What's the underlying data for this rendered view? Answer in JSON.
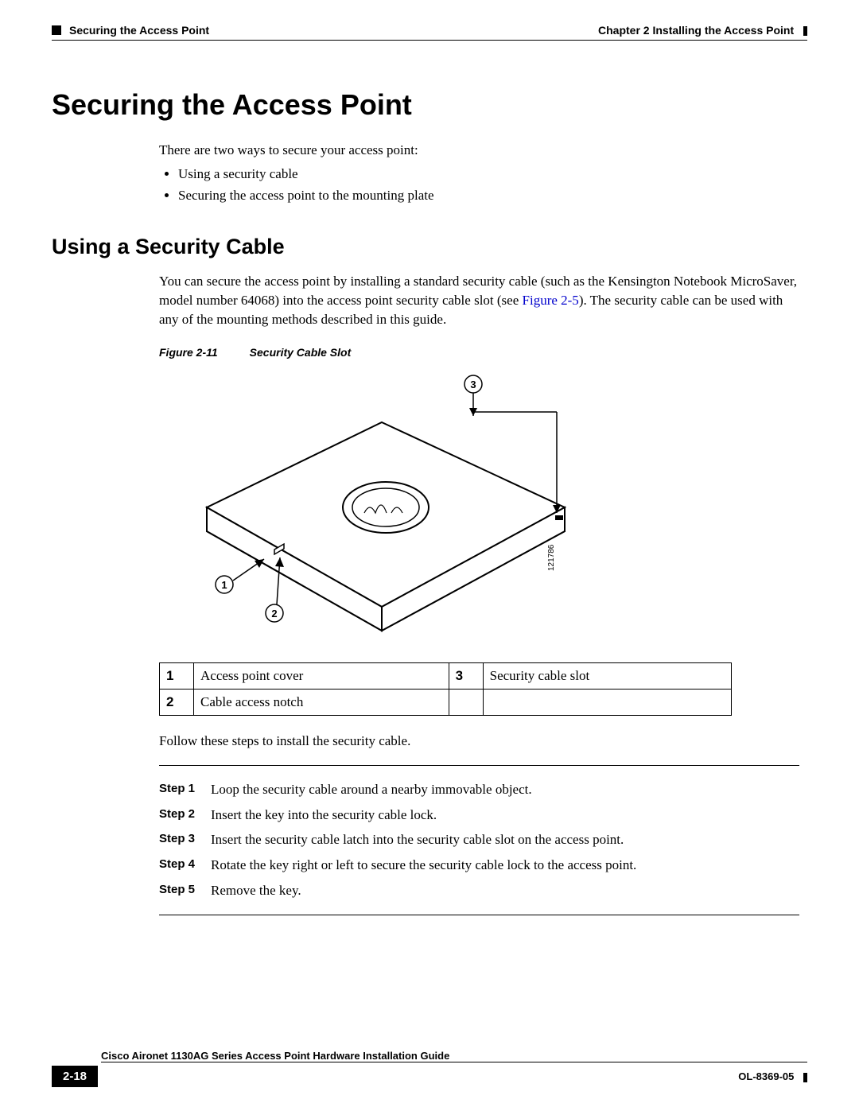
{
  "header": {
    "left_section": "Securing the Access Point",
    "right_chapter": "Chapter 2      Installing the Access Point"
  },
  "h1": "Securing the Access Point",
  "intro": "There are two ways to secure your access point:",
  "bullets": [
    "Using a security cable",
    "Securing the access point to the mounting plate"
  ],
  "h2": "Using a Security Cable",
  "para2_pre": "You can secure the access point by installing a standard security cable (such as the Kensington Notebook MicroSaver, model number 64068) into the access point security cable slot (see ",
  "para2_link": "Figure 2-5",
  "para2_post": "). The security cable can be used with any of the mounting methods described in this guide.",
  "figure_label": "Figure 2-11",
  "figure_title": "Security Cable Slot",
  "figure_drawing_no": "121786",
  "callouts": {
    "c1": "1",
    "c2": "2",
    "c3": "3"
  },
  "legend": [
    {
      "n": "1",
      "t": "Access point cover"
    },
    {
      "n": "2",
      "t": "Cable access notch"
    },
    {
      "n": "3",
      "t": "Security cable slot"
    }
  ],
  "follow": "Follow these steps to install the security cable.",
  "steps": [
    {
      "label": "Step 1",
      "text": "Loop the security cable around a nearby immovable object."
    },
    {
      "label": "Step 2",
      "text": "Insert the key into the security cable lock."
    },
    {
      "label": "Step 3",
      "text": "Insert the security cable latch into the security cable slot on the access point."
    },
    {
      "label": "Step 4",
      "text": "Rotate the key right or left to secure the security cable lock to the access point."
    },
    {
      "label": "Step 5",
      "text": "Remove the key."
    }
  ],
  "footer": {
    "guide": "Cisco Aironet 1130AG Series Access Point Hardware Installation Guide",
    "page": "2-18",
    "doc": "OL-8369-05"
  }
}
